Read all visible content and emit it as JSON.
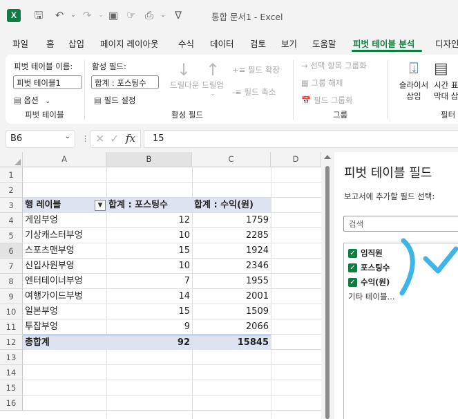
{
  "title": {
    "doc": "통합 문서1",
    "sep": "-",
    "app": "Excel"
  },
  "menu": [
    "파일",
    "홈",
    "삽입",
    "페이지 레이아웃",
    "수식",
    "데이터",
    "검토",
    "보기",
    "도움말",
    "피벗 테이블 분석",
    "디자인"
  ],
  "ribbon": {
    "pivot_name_label": "피벗 테이블 이름:",
    "pivot_name_value": "피벗 테이블1",
    "options_label": "옵션",
    "group1": "피벗 테이블",
    "active_field_label": "활성 필드:",
    "active_field_value": "합계 : 포스팅수",
    "field_settings": "필드 설정",
    "drill_down": "드릴다운",
    "drill_up": "드릴업",
    "expand_field": "필드 확장",
    "collapse_field": "필드 축소",
    "group2": "활성 필드",
    "group_selection": "선택 항목 그룹화",
    "ungroup": "그룹 해제",
    "group_field": "필드 그룹화",
    "group3": "그룹",
    "slicer_l1": "슬라이서",
    "slicer_l2": "삽입",
    "timeline_l1": "시간 표",
    "timeline_l2": "막대 삽",
    "group4": "필터"
  },
  "formula": {
    "cell_ref": "B6",
    "value": "15"
  },
  "columns": [
    "A",
    "B",
    "C",
    "D"
  ],
  "rows": [
    "1",
    "2",
    "3",
    "4",
    "5",
    "6",
    "7",
    "8",
    "9",
    "10",
    "11",
    "12",
    "13",
    "14",
    "15",
    "16"
  ],
  "pivot": {
    "headers": [
      "행 레이블",
      "합계 : 포스팅수",
      "합계 : 수익(원)"
    ],
    "rows": [
      [
        "게임부엉",
        "12",
        "1759"
      ],
      [
        "기상캐스터부엉",
        "10",
        "2285"
      ],
      [
        "스포츠맨부엉",
        "15",
        "1924"
      ],
      [
        "신입사원부엉",
        "10",
        "2346"
      ],
      [
        "엔터테이너부엉",
        "7",
        "1955"
      ],
      [
        "여행가이드부벙",
        "14",
        "2001"
      ],
      [
        "일본부엉",
        "15",
        "1509"
      ],
      [
        "투잡부엉",
        "9",
        "2066"
      ]
    ],
    "total": [
      "총합계",
      "92",
      "15845"
    ]
  },
  "pane": {
    "title": "피벗 테이블 필드",
    "subtitle": "보고서에 추가할 필드 선택:",
    "search_placeholder": "검색",
    "fields": [
      "임직원",
      "포스팅수",
      "수익(원)"
    ],
    "more": "기타 테이블..."
  },
  "colors": {
    "accent": "#107c41",
    "pivot_header": "#dde3f0",
    "annotation": "#3fb4e8"
  }
}
